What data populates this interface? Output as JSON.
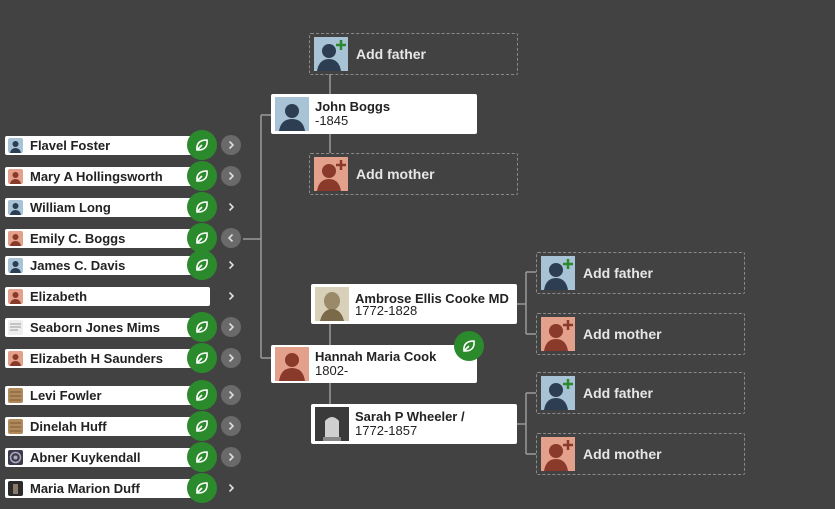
{
  "list": [
    {
      "name": "Flavel Foster",
      "gender": "male",
      "hint": true,
      "chevron": "filled"
    },
    {
      "name": "Mary A Hollingsworth",
      "gender": "female",
      "hint": true,
      "chevron": "filled"
    },
    {
      "name": "William Long",
      "gender": "male",
      "hint": true,
      "chevron": "plain"
    },
    {
      "name": "Emily C. Boggs",
      "gender": "female",
      "hint": true,
      "chevron": "filled-left"
    },
    {
      "name": "James C. Davis",
      "gender": "male",
      "hint": true,
      "chevron": "plain"
    },
    {
      "name": "Elizabeth",
      "gender": "female",
      "hint": false,
      "chevron": "plain"
    },
    {
      "name": "Seaborn Jones Mims",
      "gender": "document",
      "hint": true,
      "chevron": "filled"
    },
    {
      "name": "Elizabeth H Saunders",
      "gender": "female",
      "hint": true,
      "chevron": "filled"
    },
    {
      "name": "Levi Fowler",
      "gender": "photo",
      "hint": true,
      "chevron": "filled"
    },
    {
      "name": "Dinelah Huff",
      "gender": "photo",
      "hint": true,
      "chevron": "filled"
    },
    {
      "name": "Abner Kuykendall",
      "gender": "badge",
      "hint": true,
      "chevron": "filled"
    },
    {
      "name": "Maria Marion Duff",
      "gender": "photo-dark",
      "hint": true,
      "chevron": "plain"
    }
  ],
  "tree": {
    "paternal_father_add": "Add father",
    "father": {
      "name": "John Boggs",
      "dates": "-1845"
    },
    "paternal_mother_add": "Add mother",
    "mother": {
      "name": "Hannah Maria Cook",
      "dates": "1802-"
    },
    "maternal_grandfather": {
      "name": "Ambrose Ellis Cooke MD",
      "dates": "1772-1828"
    },
    "maternal_grandmother": {
      "name": "Sarah P Wheeler /",
      "dates": "1772-1857"
    },
    "gf_father_add": "Add father",
    "gf_mother_add": "Add mother",
    "gm_father_add": "Add father",
    "gm_mother_add": "Add mother"
  },
  "colors": {
    "background": "#424242",
    "hint_green": "#2b8a2b",
    "male_bg": "#a9c3d6",
    "female_bg": "#e3a08a"
  }
}
